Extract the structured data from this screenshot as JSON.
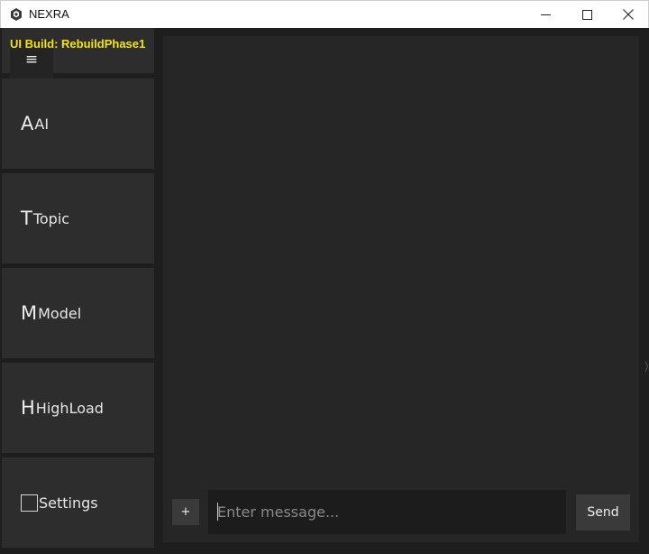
{
  "window": {
    "title": "NEXRA",
    "app_icon": "cube-icon",
    "controls": [
      "minimize-icon",
      "maximize-icon",
      "close-icon"
    ]
  },
  "sidebar": {
    "build_label": "UI Build: RebuildPhase1",
    "menu_icon": "≡",
    "items": [
      {
        "glyph": "A",
        "label": "AI"
      },
      {
        "glyph": "T",
        "label": "Topic"
      },
      {
        "glyph": "M",
        "label": "Model"
      },
      {
        "glyph": "H",
        "label": "HighLoad"
      },
      {
        "glyph": "",
        "label": "Settings",
        "icon": "checkbox-icon"
      }
    ]
  },
  "composer": {
    "attach_label": "+",
    "placeholder": "Enter message...",
    "value": "",
    "send_label": "Send"
  },
  "colors": {
    "background": "#1e1e1e",
    "panel": "#2d2d2d",
    "chat_bg": "#262626",
    "input_bg": "#1c1c1c",
    "button_bg": "#3a3a3a",
    "build_label": "#f2e21b"
  }
}
